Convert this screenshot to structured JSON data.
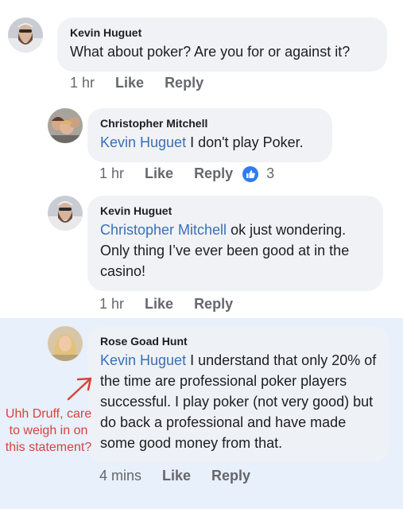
{
  "comments": [
    {
      "author": "Kevin Huguet",
      "text": "What about poker? Are you for or against it?",
      "time": "1 hr",
      "like_label": "Like",
      "reply_label": "Reply"
    },
    {
      "author": "Christopher Mitchell",
      "mention": "Kevin Huguet",
      "text": " I don't play Poker.",
      "time": "1 hr",
      "like_label": "Like",
      "reply_label": "Reply",
      "reaction_count": "3"
    },
    {
      "author": "Kevin Huguet",
      "mention": "Christopher Mitchell",
      "text": " ok just wondering. Only thing I’ve ever been good at in the casino!",
      "time": "1 hr",
      "like_label": "Like",
      "reply_label": "Reply"
    },
    {
      "author": "Rose Goad Hunt",
      "mention": "Kevin Huguet",
      "text": " I understand that only 20% of the time are professional poker players successful. I play poker (not very good) but do back a professional and have made some good money from that.",
      "time": "4 mins",
      "like_label": "Like",
      "reply_label": "Reply"
    }
  ],
  "annotation": {
    "text": "Uhh Druff, care to weigh in on this statement?",
    "color": "#d9433a"
  },
  "colors": {
    "mention": "#3a6fb5",
    "bubble": "#f0f2f5",
    "highlight": "#e7f0fb",
    "like_badge": "#2d7cf6"
  }
}
